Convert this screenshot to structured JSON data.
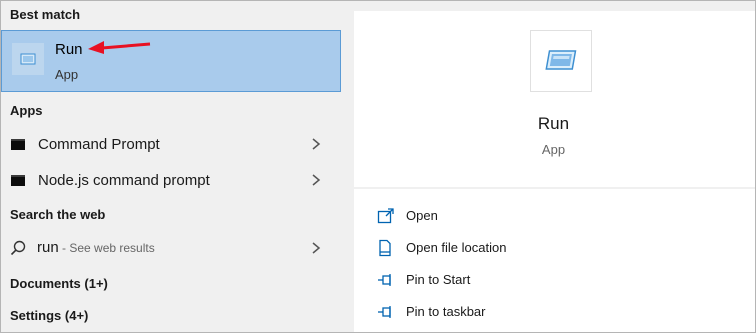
{
  "sections": {
    "best_match": "Best match",
    "apps": "Apps",
    "search_web": "Search the web",
    "documents": "Documents (1+)",
    "settings": "Settings (4+)"
  },
  "best_match": {
    "title": "Run",
    "subtitle": "App",
    "icon": "run-app-icon"
  },
  "apps": [
    {
      "label": "Command Prompt",
      "icon": "cmd-icon"
    },
    {
      "label": "Node.js command prompt",
      "icon": "cmd-icon"
    }
  ],
  "web": {
    "query": "run",
    "suffix": " - See web results",
    "icon": "search-icon"
  },
  "preview": {
    "title": "Run",
    "subtitle": "App",
    "actions": [
      {
        "label": "Open",
        "icon": "open-icon"
      },
      {
        "label": "Open file location",
        "icon": "file-location-icon"
      },
      {
        "label": "Pin to Start",
        "icon": "pin-icon"
      },
      {
        "label": "Pin to taskbar",
        "icon": "pin-icon"
      }
    ]
  },
  "colors": {
    "selection": "#a9cbec",
    "accent": "#0063b1",
    "arrow": "#e81123"
  }
}
